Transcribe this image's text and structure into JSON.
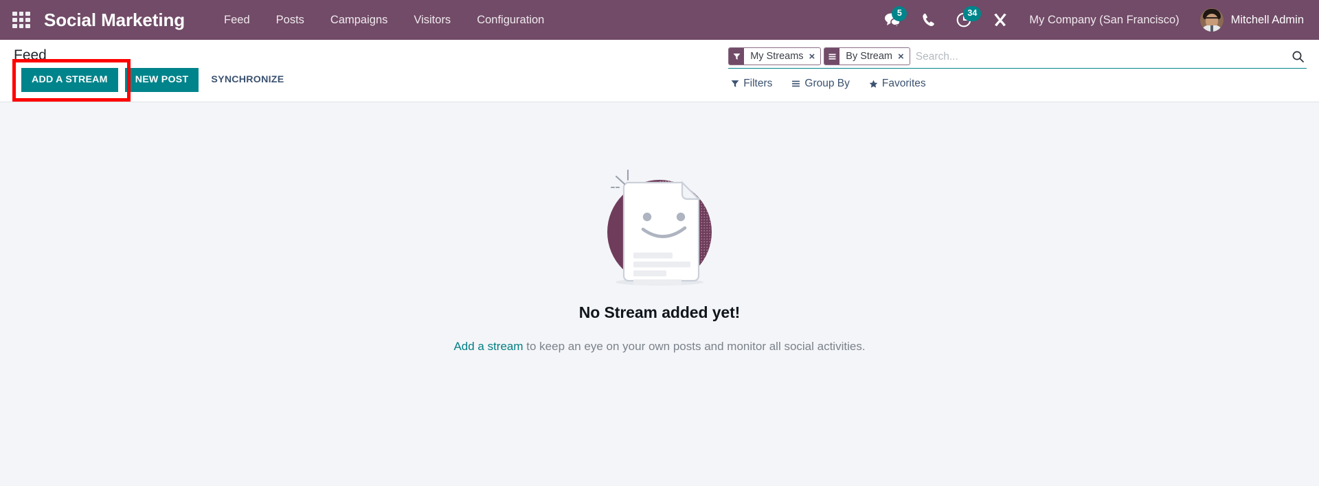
{
  "navbar": {
    "apps_icon": "apps-grid-icon",
    "brand": "Social Marketing",
    "menu": [
      {
        "label": "Feed"
      },
      {
        "label": "Posts"
      },
      {
        "label": "Campaigns"
      },
      {
        "label": "Visitors"
      },
      {
        "label": "Configuration"
      }
    ],
    "systray": {
      "messages_icon": "chat-bubbles-icon",
      "messages_count": "5",
      "voip_icon": "phone-icon",
      "activities_icon": "clock-activity-icon",
      "activities_count": "34",
      "debug_icon": "wrench-tools-icon"
    },
    "company": "My Company (San Francisco)",
    "user": "Mitchell Admin",
    "avatar_icon": "user-avatar"
  },
  "control_panel": {
    "breadcrumb": "Feed",
    "buttons": {
      "add_stream": "ADD A STREAM",
      "new_post": "NEW POST",
      "synchronize": "SYNCHRONIZE"
    },
    "search": {
      "placeholder": "Search...",
      "value": "",
      "search_icon": "magnifier-icon",
      "facets": [
        {
          "label": "My Streams",
          "icon": "filter-funnel-icon",
          "close": "×"
        },
        {
          "label": "By Stream",
          "icon": "group-by-bars-icon",
          "close": "×"
        }
      ]
    },
    "toggles": [
      {
        "label": "Filters",
        "icon": "filter-funnel-icon"
      },
      {
        "label": "Group By",
        "icon": "group-by-bars-icon"
      },
      {
        "label": "Favorites",
        "icon": "star-icon"
      }
    ]
  },
  "main": {
    "illustration_icon": "empty-document-smiley-illustration",
    "title": "No Stream added yet!",
    "subtitle_link": "Add a stream",
    "subtitle_rest": " to keep an eye on your own posts and monitor all social activities."
  },
  "colors": {
    "navbar_purple": "#714B67",
    "accent_teal": "#00848B",
    "link_teal": "#017E84",
    "highlight_red": "#FF0000",
    "page_bg": "#F4F5F8"
  }
}
